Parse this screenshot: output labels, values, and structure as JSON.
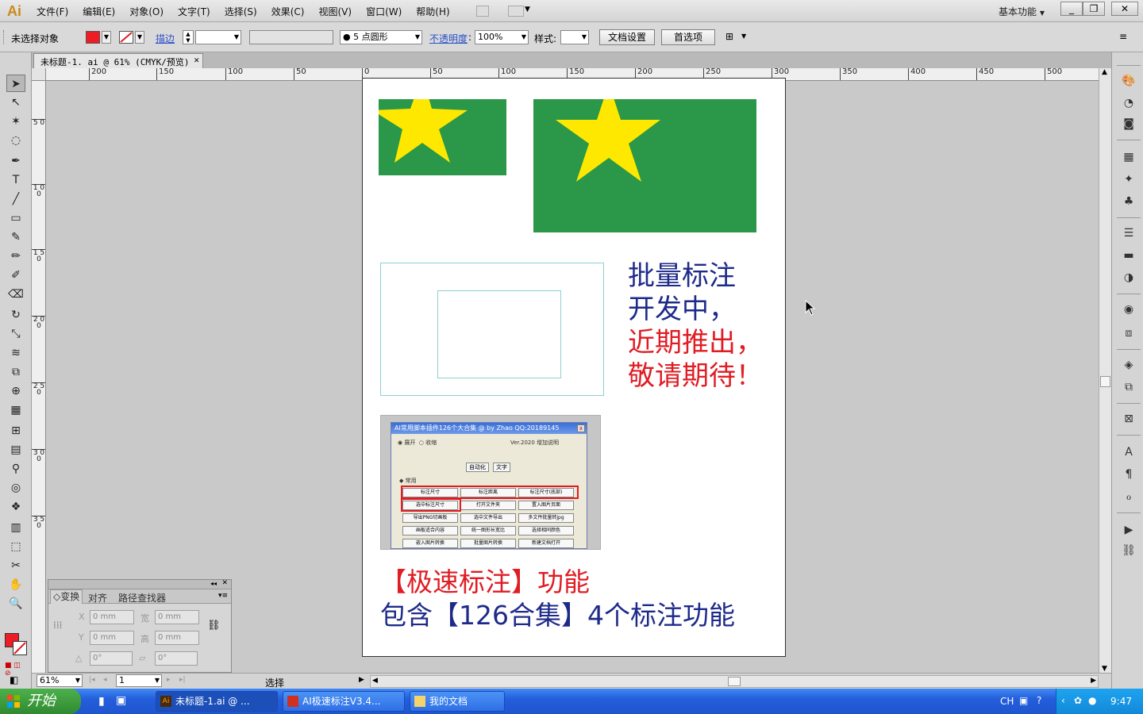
{
  "app": {
    "logo": "Ai",
    "menus": [
      "文件(F)",
      "编辑(E)",
      "对象(O)",
      "文字(T)",
      "选择(S)",
      "效果(C)",
      "视图(V)",
      "窗口(W)",
      "帮助(H)"
    ],
    "workspace": "基本功能",
    "window_buttons": [
      "_",
      "❐",
      "✕"
    ]
  },
  "controlbar": {
    "selection": "未选择对象",
    "stroke_link": "描边",
    "brush": "5 点圆形",
    "opacity_link": "不透明度",
    "opacity_value": "100%",
    "style_label": "样式:",
    "doc_setup": "文档设置",
    "preferences": "首选项"
  },
  "document": {
    "tab": "未标题-1. ai @ 61% (CMYK/预览)",
    "tab_close": "✕"
  },
  "ruler": {
    "h_ticks": [
      "200",
      "150",
      "100",
      "50",
      "0",
      "50",
      "100",
      "150",
      "200",
      "250",
      "300",
      "350",
      "400",
      "450",
      "500"
    ],
    "v_ticks": [
      "5 0",
      "1 0 0",
      "1 5 0",
      "2 0 0",
      "2 5 0",
      "3 0 0",
      "3 5 0"
    ]
  },
  "artboard": {
    "notice_lines": [
      {
        "text": "批量标注",
        "color": "blue"
      },
      {
        "text": "开发中，",
        "color": "blue"
      },
      {
        "text": "近期推出，",
        "color": "red"
      },
      {
        "text": "敬请期待！",
        "color": "red"
      }
    ],
    "feature_line1": "【极速标注】功能",
    "feature_line2": "包含【126合集】4个标注功能",
    "thumb": {
      "title": "AI常用脚本插件126个大合集 @ by Zhao QQ:20189145",
      "radio1": "展开",
      "radio2": "收缩",
      "version": "Ver.2020 增加说明",
      "tabs": [
        "自动化",
        "文字"
      ],
      "section": "常用",
      "buttons": [
        "标注尺寸",
        "标注距离",
        "标注尺寸(底部)",
        "选中标注尺寸",
        "打开文件夹",
        "置入图片页面",
        "导出PNG切画板",
        "选中文件导出",
        "多文件批量转jpg",
        "画板适合内容",
        "统一图形长宽比",
        "选择相同颜色",
        "嵌入图片转换",
        "批量图片转换",
        "新建文档打开"
      ]
    }
  },
  "colors": {
    "accent_blue": "#1e2a8a",
    "accent_red": "#e01c24",
    "flag_green": "#2a9848",
    "star_yellow": "#ffe800",
    "fill_swatch": "#ee1c24"
  },
  "transform_panel": {
    "tabs": [
      "变换",
      "对齐",
      "路径查找器"
    ],
    "x_label": "X",
    "y_label": "Y",
    "w_label": "宽",
    "h_label": "高",
    "x_value": "0 mm",
    "y_value": "0 mm",
    "w_value": "0 mm",
    "h_value": "0 mm",
    "rotate_value": "0°",
    "shear_value": "0°"
  },
  "statusbar": {
    "zoom": "61%",
    "page": "1",
    "mode": "选择"
  },
  "taskbar": {
    "start": "开始",
    "tasks": [
      "未标题-1.ai @ ...",
      "AI极速标注V3.4...",
      "我的文档"
    ],
    "lang": "CH",
    "clock": "9:47"
  }
}
